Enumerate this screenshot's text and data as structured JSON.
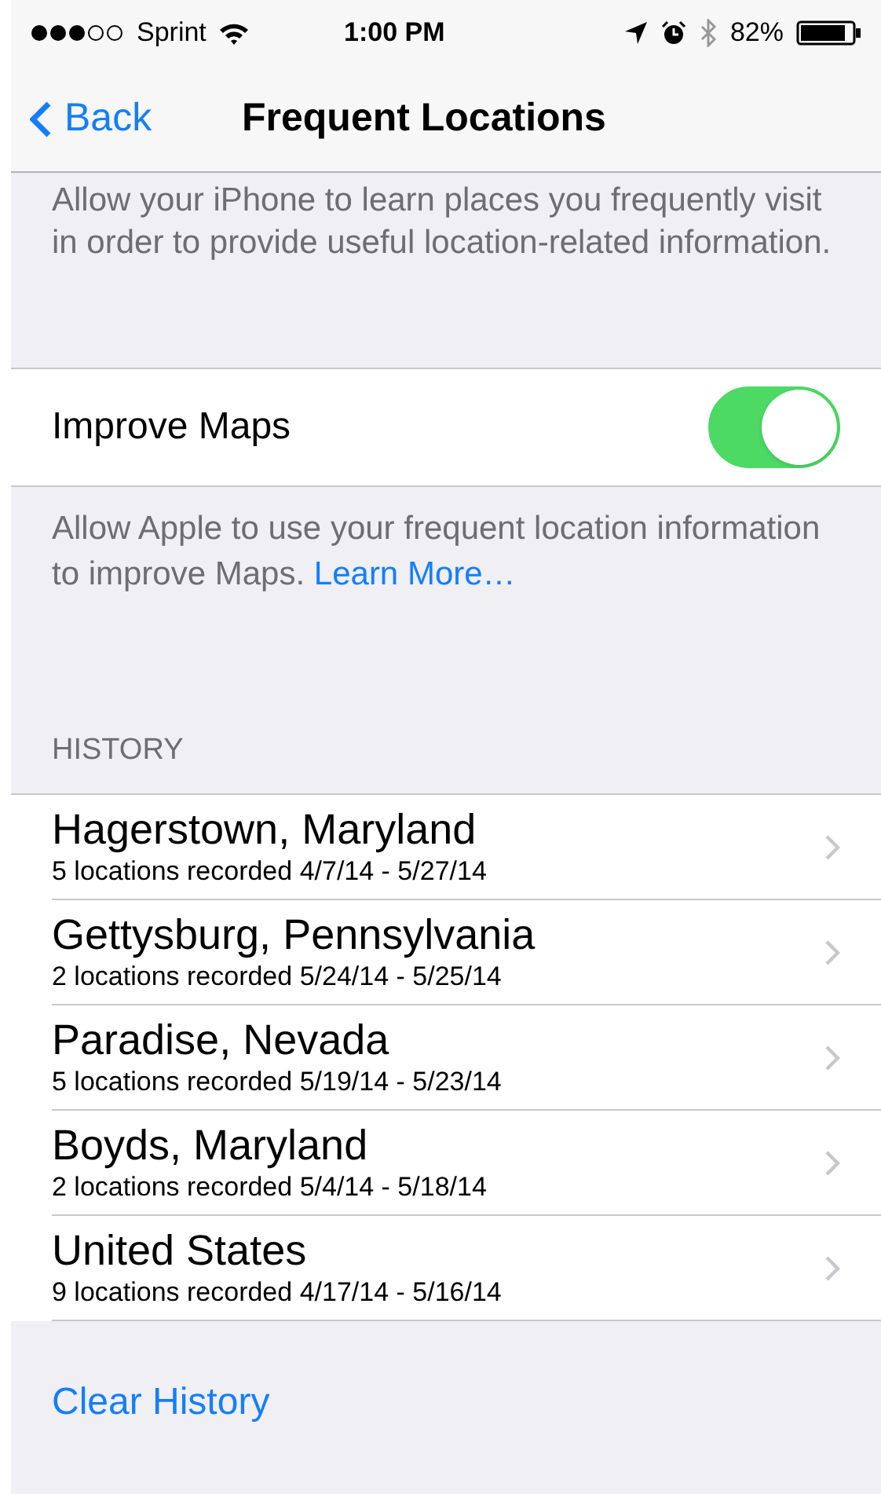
{
  "status_bar": {
    "carrier": "Sprint",
    "time": "1:00 PM",
    "battery": "82%"
  },
  "nav": {
    "back": "Back",
    "title": "Frequent Locations"
  },
  "intro": "Allow your iPhone to learn places you frequently visit in order to provide useful location-related information.",
  "improve_maps": {
    "label": "Improve Maps",
    "on": true
  },
  "footer": {
    "text": "Allow Apple to use your frequent location information to improve Maps.",
    "link": "Learn More…"
  },
  "history": {
    "header": "HISTORY",
    "items": [
      {
        "title": "Hagerstown, Maryland",
        "subtitle": "5 locations recorded 4/7/14 - 5/27/14"
      },
      {
        "title": "Gettysburg, Pennsylvania",
        "subtitle": "2 locations recorded 5/24/14 - 5/25/14"
      },
      {
        "title": "Paradise, Nevada",
        "subtitle": "5 locations recorded 5/19/14 - 5/23/14"
      },
      {
        "title": "Boyds, Maryland",
        "subtitle": "2 locations recorded 5/4/14 - 5/18/14"
      },
      {
        "title": "United States",
        "subtitle": "9 locations recorded 4/17/14 - 5/16/14"
      }
    ]
  },
  "clear_history": "Clear History"
}
